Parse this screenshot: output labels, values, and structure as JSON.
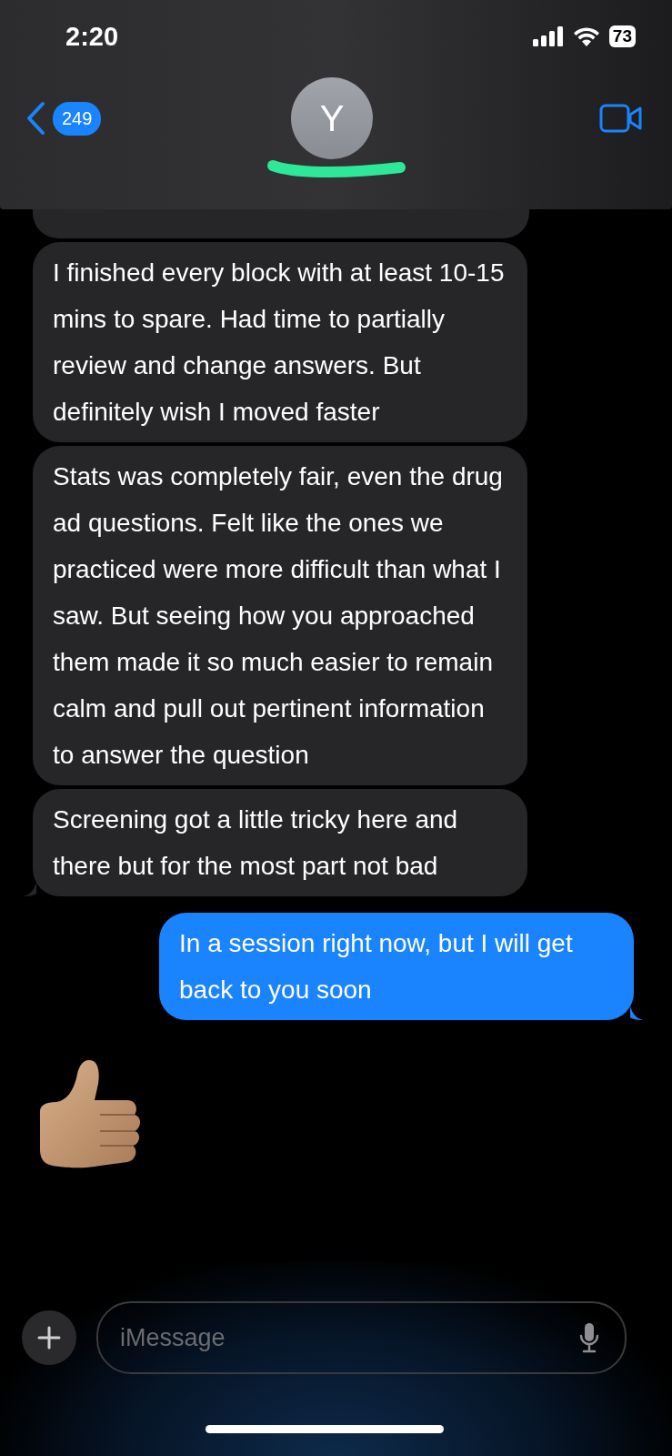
{
  "status_bar": {
    "time": "2:20",
    "battery": "73"
  },
  "header": {
    "back_count": "249",
    "avatar_initial": "Y"
  },
  "messages": [
    {
      "kind": "fragment"
    },
    {
      "kind": "received",
      "tail": false,
      "text": "I finished every block with at least 10-15 mins to spare. Had time to partially review and change answers. But definitely wish I moved faster"
    },
    {
      "kind": "received",
      "tail": false,
      "text": "Stats was completely fair, even the drug ad questions. Felt like the ones we practiced were more difficult than what I saw. But seeing how you approached them made it so much easier to remain calm and pull out pertinent information to answer the question"
    },
    {
      "kind": "received",
      "tail": true,
      "text": "Screening got a little tricky here and there but for the most part not bad"
    },
    {
      "kind": "sent",
      "tail": true,
      "text": "In a session right now, but I will get back to you soon"
    },
    {
      "kind": "reaction"
    }
  ],
  "composer": {
    "placeholder": "iMessage"
  }
}
